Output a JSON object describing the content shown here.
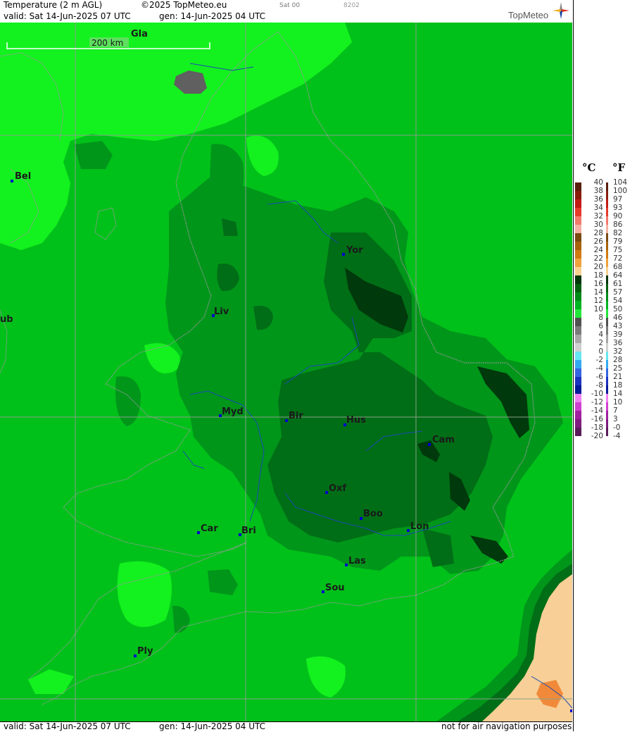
{
  "header": {
    "title": "Temperature (2 m AGL)",
    "copyright": "©2025 TopMeteo.eu",
    "run_label": "Sat 00",
    "code": "8202",
    "valid": "valid:  Sat  14-Jun-2025  07 UTC",
    "generated": "gen: 14-Jun-2025 04 UTC",
    "logo": "TopMeteo"
  },
  "footer": {
    "valid": "valid:  Sat  14-Jun-2025  07 UTC",
    "generated": "gen: 14-Jun-2025 04 UTC",
    "disclaimer": "not for air navigation purposes"
  },
  "scale": {
    "label": "200 km"
  },
  "cities": [
    {
      "label": "Gla"
    },
    {
      "label": "Bel"
    },
    {
      "label": "Yor"
    },
    {
      "label": "Liv"
    },
    {
      "label": "ub"
    },
    {
      "label": "Myd"
    },
    {
      "label": "Bir"
    },
    {
      "label": "Hus"
    },
    {
      "label": "Cam"
    },
    {
      "label": "Oxf"
    },
    {
      "label": "Boo"
    },
    {
      "label": "Lon"
    },
    {
      "label": "Car"
    },
    {
      "label": "Bri"
    },
    {
      "label": "Las"
    },
    {
      "label": "Sou"
    },
    {
      "label": "Ply"
    }
  ],
  "legend": {
    "unit_c": "°C",
    "unit_f": "°F",
    "celsius": [
      "40",
      "38",
      "36",
      "34",
      "32",
      "30",
      "28",
      "26",
      "24",
      "22",
      "20",
      "18",
      "16",
      "14",
      "12",
      "10",
      "8",
      "6",
      "4",
      "2",
      "0",
      "-2",
      "-4",
      "-6",
      "-8",
      "-10",
      "-12",
      "-14",
      "-16",
      "-18",
      "-20"
    ],
    "fahrenheit": [
      "104",
      "100",
      "97",
      "93",
      "90",
      "86",
      "82",
      "79",
      "75",
      "72",
      "68",
      "64",
      "61",
      "57",
      "54",
      "50",
      "46",
      "43",
      "39",
      "36",
      "32",
      "28",
      "25",
      "21",
      "18",
      "14",
      "10",
      "7",
      "3",
      "-0",
      "-4"
    ],
    "colors": [
      "#5a1e0c",
      "#8a1c0c",
      "#c21a14",
      "#e63a2a",
      "#f27a6c",
      "#f4b0a4",
      "#7a4a10",
      "#a8620c",
      "#d07a10",
      "#f0a23c",
      "#f8d090",
      "#00350a",
      "#00600f",
      "#008a17",
      "#00b322",
      "#22e63a",
      "#505050",
      "#7a7a7a",
      "#a6a6a6",
      "#cfcfcf",
      "#66e6f0",
      "#33aaf0",
      "#3366e0",
      "#1a33c0",
      "#001a99",
      "#f080f0",
      "#d040d0",
      "#a020a0",
      "#801a80",
      "#5a1a5a"
    ]
  },
  "colors": {
    "bright_green": "#13f11e",
    "green": "#00c119",
    "mid_green": "#00961a",
    "dark_green": "#006e16",
    "very_dark_green": "#00390b",
    "grey_patch": "#606060",
    "sand": "#f8cf96",
    "orange": "#f08a3a"
  }
}
